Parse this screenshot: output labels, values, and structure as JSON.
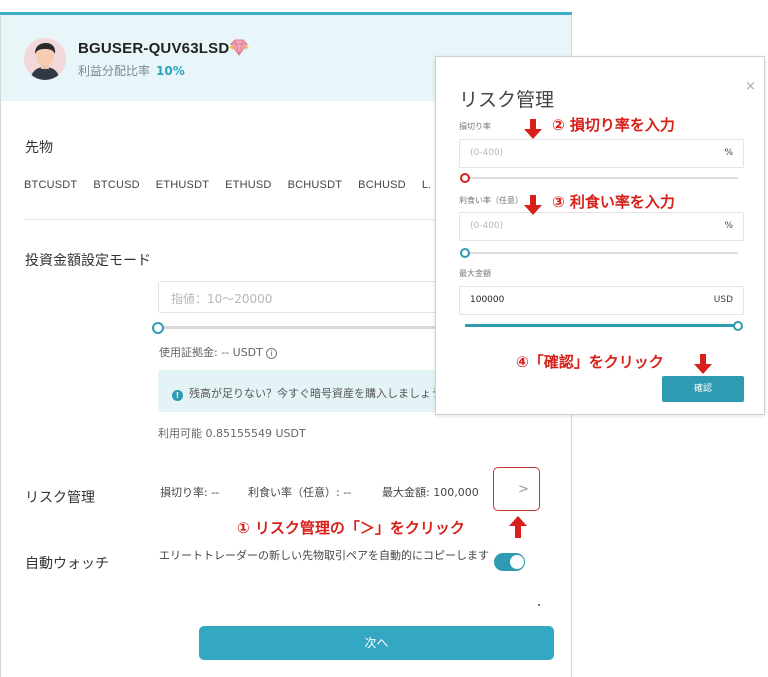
{
  "profile": {
    "username": "BGUSER-QUV63LSD",
    "profit_share_label": "利益分配比率",
    "profit_share_value": "10%"
  },
  "futures": {
    "label": "先物",
    "pairs": [
      "BTCUSDT",
      "BTCUSD",
      "ETHUSDT",
      "ETHUSD",
      "BCHUSDT",
      "BCHUSD",
      "L."
    ]
  },
  "investment": {
    "label": "投資金額設定モード",
    "input_placeholder": "指値：10～20000",
    "margin_text": "使用証拠金: -- USDT",
    "notice_text": "残高が足りない？今すぐ暗号資産を購入しましょう",
    "available_text": "利用可能 0.85155549 USDT"
  },
  "risk": {
    "label": "リスク管理",
    "stop_loss": "損切り率: --",
    "take_profit": "利食い率（任意）: --",
    "max_amount": "最大金額: 100,000",
    "chevron": ">"
  },
  "autowatch": {
    "label": "自動ウォッチ",
    "description": "エリートトレーダーの新しい先物取引ペアを自動的にコピーします",
    "enabled": true
  },
  "next_button": "次へ",
  "dialog": {
    "title": "リスク管理",
    "close": "×",
    "stop_loss_label": "損切り率",
    "stop_loss_placeholder": "(0-400)",
    "stop_loss_unit": "%",
    "take_profit_label": "利食い率（任意）",
    "take_profit_placeholder": "(0-400)",
    "take_profit_unit": "%",
    "max_amount_label": "最大金額",
    "max_amount_value": "100000",
    "max_amount_unit": "USD",
    "confirm_button": "確認"
  },
  "annotations": {
    "step1": "① リスク管理の「＞」をクリック",
    "step2": "② 損切り率を入力",
    "step3": "③ 利食い率を入力",
    "step4": "④「確認」をクリック"
  },
  "colors": {
    "accent": "#2e9bb3",
    "annotation_red": "#d8201a",
    "header_band": "#e9f6f9"
  }
}
